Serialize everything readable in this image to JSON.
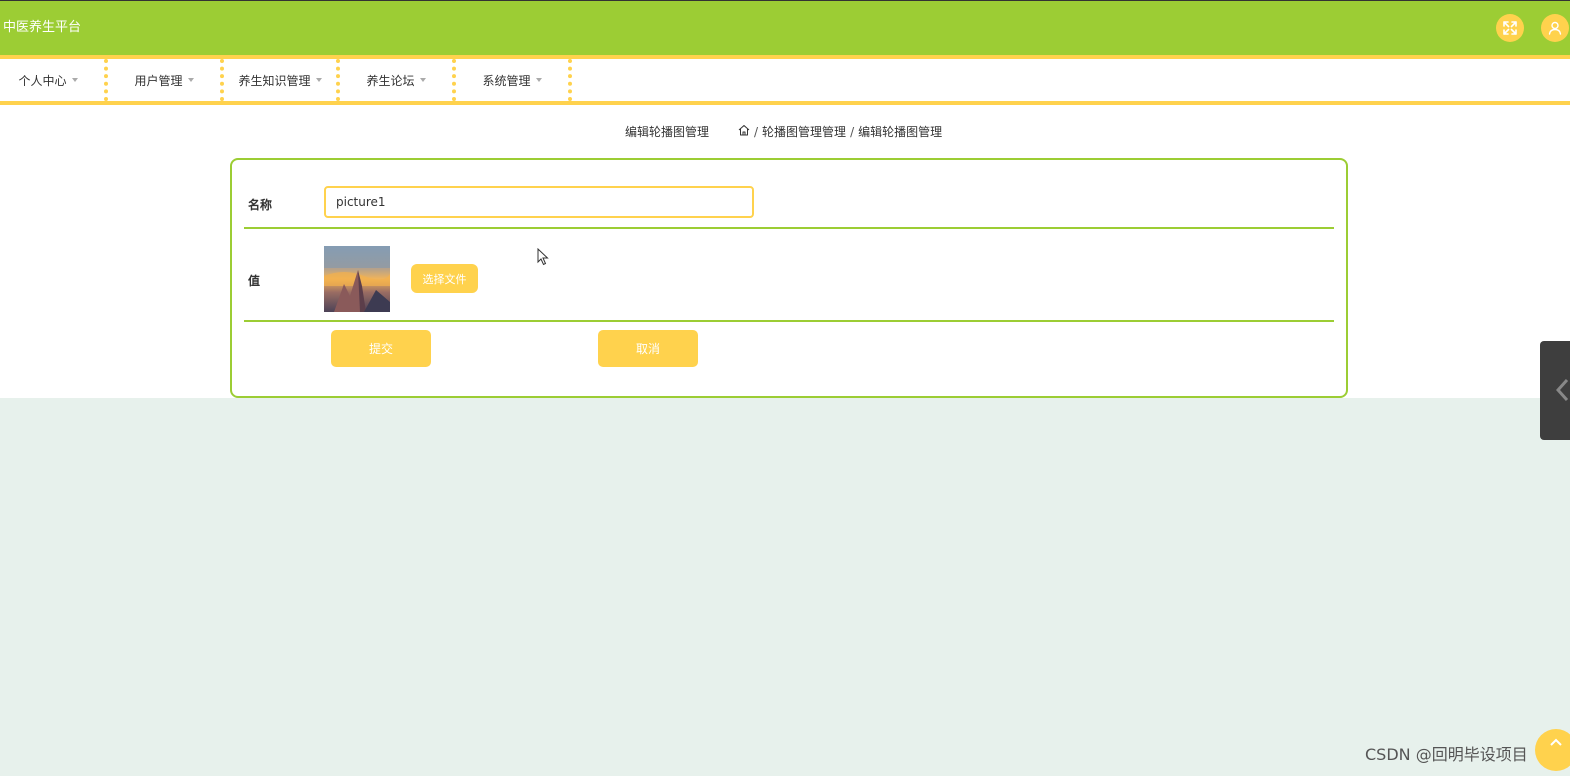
{
  "header": {
    "app_title": "中医养生平台",
    "icons": [
      "fullscreen-icon",
      "user-icon"
    ]
  },
  "nav": {
    "items": [
      {
        "label": "个人中心"
      },
      {
        "label": "用户管理"
      },
      {
        "label": "养生知识管理"
      },
      {
        "label": "养生论坛"
      },
      {
        "label": "系统管理"
      }
    ]
  },
  "page": {
    "heading": "编辑轮播图管理",
    "breadcrumb": {
      "home_icon": "home-icon",
      "items": [
        "轮播图管理管理",
        "编辑轮播图管理"
      ]
    }
  },
  "form": {
    "name_label": "名称",
    "name_value": "picture1",
    "value_label": "值",
    "file_button": "选择文件",
    "submit_button": "提交",
    "cancel_button": "取消"
  },
  "footer": {
    "watermark": "CSDN @回明毕设项目"
  },
  "colors": {
    "brand_green": "#9ccd34",
    "accent_yellow": "#ffd24d",
    "page_bg": "#e7f1ec"
  }
}
